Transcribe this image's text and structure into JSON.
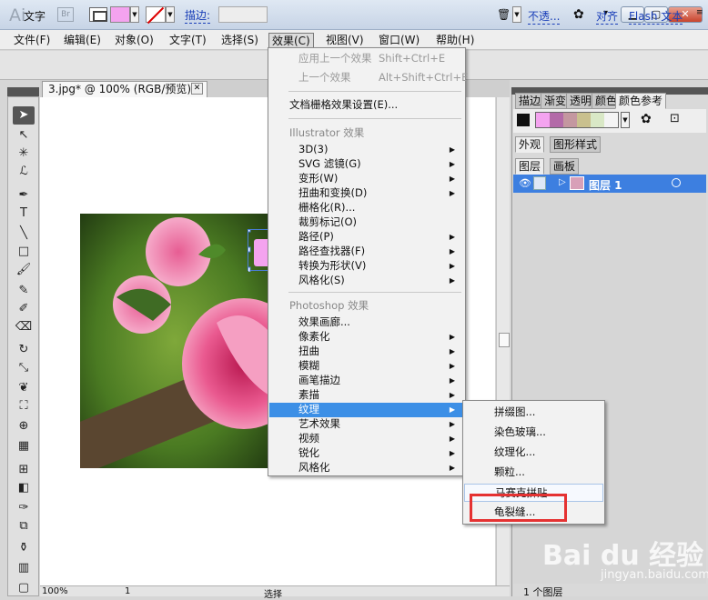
{
  "app": {
    "logo": "Ai",
    "bridge": "Br",
    "caret": "▾"
  },
  "window_controls": {
    "minimize": "▁",
    "maximize": "▢",
    "close": "✕"
  },
  "menubar": {
    "items": [
      "文件(F)",
      "编辑(E)",
      "对象(O)",
      "文字(T)",
      "选择(S)",
      "效果(C)",
      "视图(V)",
      "窗口(W)",
      "帮助(H)"
    ],
    "active": "效果(C)"
  },
  "control_bar": {
    "label": "文字",
    "fill_color": "#f4a3ef",
    "stroke_link": "描边:",
    "opacity_link": "不透...",
    "align_link": "对齐",
    "flash_link": "Flash 文本"
  },
  "document": {
    "tab_title": "3.jpg* @ 100% (RGB/预览)",
    "tab_close": "✕",
    "zoom": "100%",
    "page": "1",
    "status": "选择"
  },
  "effect_menu": {
    "apply_last": {
      "label": "应用上一个效果",
      "shortcut": "Shift+Ctrl+E"
    },
    "last_effect": {
      "label": "上一个效果",
      "shortcut": "Alt+Shift+Ctrl+E"
    },
    "raster_settings": "文档栅格效果设置(E)...",
    "illustrator_header": "Illustrator 效果",
    "illustrator_items": [
      "3D(3)",
      "SVG 滤镜(G)",
      "变形(W)",
      "扭曲和变换(D)",
      "栅格化(R)...",
      "裁剪标记(O)",
      "路径(P)",
      "路径查找器(F)",
      "转换为形状(V)",
      "风格化(S)"
    ],
    "photoshop_header": "Photoshop 效果",
    "photoshop_items": [
      "效果画廊...",
      "像素化",
      "扭曲",
      "模糊",
      "画笔描边",
      "素描",
      "纹理",
      "艺术效果",
      "视频",
      "锐化",
      "风格化"
    ],
    "highlighted": "纹理"
  },
  "texture_submenu": {
    "items": [
      "拼缀图...",
      "染色玻璃...",
      "纹理化...",
      "颗粒...",
      "马赛克拼贴",
      "龟裂缝..."
    ]
  },
  "right_panel": {
    "tabs_top": [
      "描边",
      "渐变",
      "透明",
      "颜色",
      "颜色参考"
    ],
    "tabs_mid": [
      "外观",
      "图形样式"
    ],
    "tabs_layers": [
      "图层",
      "画板"
    ],
    "layer_name": "图层 1",
    "layer_count": "1 个图层",
    "swatches": [
      "#f4a3ef",
      "#b36aa8",
      "#c497a0",
      "#c9c08e",
      "#d9e8c6",
      "#f4f4f4"
    ]
  },
  "watermark": {
    "main": "Bai du 经验",
    "sub": "jingyan.baidu.com"
  }
}
